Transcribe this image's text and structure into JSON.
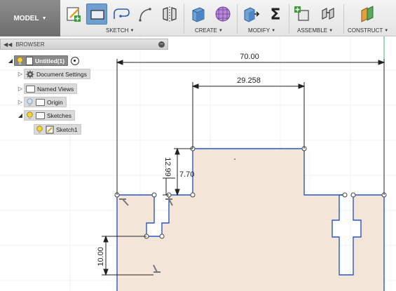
{
  "toolbar": {
    "workspace": "MODEL",
    "groups": {
      "sketch": "SKETCH",
      "create": "CREATE",
      "modify": "MODIFY",
      "assemble": "ASSEMBLE",
      "construct": "CONSTRUCT"
    },
    "tool_icons": [
      "create-sketch-icon",
      "rectangle-icon",
      "line-icon",
      "arc-icon",
      "mirror-icon",
      "extrude-icon",
      "form-icon",
      "press-pull-icon",
      "sigma-icon",
      "new-component-icon",
      "joint-icon",
      "plane-icon"
    ],
    "active_tool": "rectangle-icon",
    "accent_color": "#6f9fd1"
  },
  "browser": {
    "title": "BROWSER",
    "root": "Untitled(1)",
    "items": [
      {
        "label": "Document Settings",
        "icon": "gear-icon"
      },
      {
        "label": "Named Views",
        "icon": "folder-icon"
      },
      {
        "label": "Origin",
        "icon": "folder-icon"
      },
      {
        "label": "Sketches",
        "icon": "folder-icon"
      },
      {
        "label": "Sketch1",
        "icon": "sketch-icon"
      }
    ]
  },
  "sketch": {
    "dimensions": {
      "total_width": "70.00",
      "top_width": "29.258",
      "step_height": "7.70",
      "small_height": "12.99",
      "slot_depth": "10.00"
    },
    "profile_fill": "#f3e6d8",
    "line_color": "#2857c5"
  }
}
